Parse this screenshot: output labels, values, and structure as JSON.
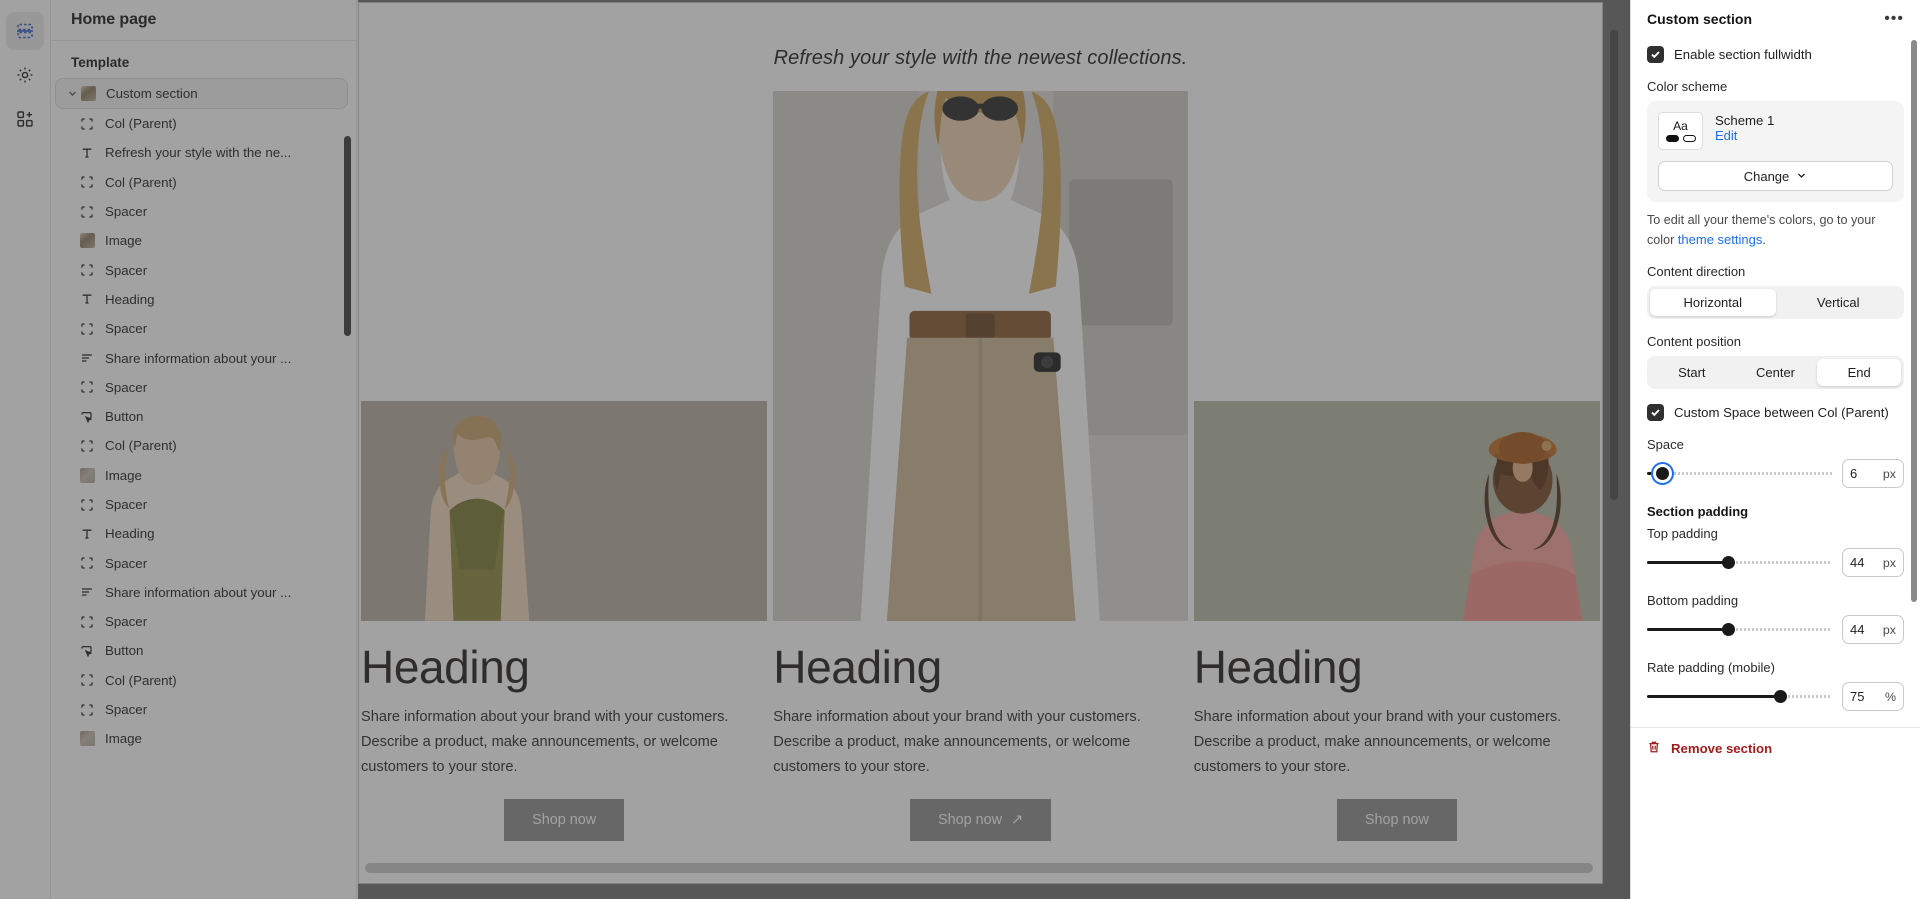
{
  "rail": {
    "items": [
      {
        "name": "sections-icon",
        "label": "Sections",
        "selected": true
      },
      {
        "name": "settings-icon",
        "label": "Theme settings",
        "selected": false
      },
      {
        "name": "app-blocks-icon",
        "label": "App embeds",
        "selected": false
      }
    ]
  },
  "sidebar": {
    "page_title": "Home page",
    "group_label": "Template",
    "section": {
      "label": "Custom section",
      "icon": "image-thumbnail"
    },
    "items": [
      {
        "label": "Col (Parent)",
        "icon": "frame-icon"
      },
      {
        "label": "Refresh your style with the ne...",
        "icon": "text-icon"
      },
      {
        "label": "Col (Parent)",
        "icon": "frame-icon"
      },
      {
        "label": "Spacer",
        "icon": "frame-icon"
      },
      {
        "label": "Image",
        "icon": "image-thumbnail"
      },
      {
        "label": "Spacer",
        "icon": "frame-icon"
      },
      {
        "label": "Heading",
        "icon": "text-icon"
      },
      {
        "label": "Spacer",
        "icon": "frame-icon"
      },
      {
        "label": "Share information about your ...",
        "icon": "paragraph-icon"
      },
      {
        "label": "Spacer",
        "icon": "frame-icon"
      },
      {
        "label": "Button",
        "icon": "button-icon"
      },
      {
        "label": "Col (Parent)",
        "icon": "frame-icon"
      },
      {
        "label": "Image",
        "icon": "image-thumbnail"
      },
      {
        "label": "Spacer",
        "icon": "frame-icon"
      },
      {
        "label": "Heading",
        "icon": "text-icon"
      },
      {
        "label": "Spacer",
        "icon": "frame-icon"
      },
      {
        "label": "Share information about your ...",
        "icon": "paragraph-icon"
      },
      {
        "label": "Spacer",
        "icon": "frame-icon"
      },
      {
        "label": "Button",
        "icon": "button-icon"
      },
      {
        "label": "Col (Parent)",
        "icon": "frame-icon"
      },
      {
        "label": "Spacer",
        "icon": "frame-icon"
      },
      {
        "label": "Image",
        "icon": "image-thumbnail"
      }
    ]
  },
  "canvas": {
    "tagline": "Refresh your style with the newest collections.",
    "columns": [
      {
        "id": "left",
        "heading": "Heading",
        "body": "Share information about your brand with your customers. Describe a product, make announcements, or welcome customers to your store.",
        "button": "Shop now",
        "button_arrow": "",
        "image_bg": "#b6ada0"
      },
      {
        "id": "center",
        "heading": "Heading",
        "body": "Share information about your brand with your customers. Describe a product, make announcements, or welcome customers to your store.",
        "button": "Shop now",
        "button_arrow": "↗",
        "image_bg": "#d9d7d2"
      },
      {
        "id": "right",
        "heading": "Heading",
        "body": "Share information about your brand with your customers. Describe a product, make announcements, or welcome customers to your store.",
        "button": "Shop now",
        "button_arrow": "",
        "image_bg": "#b7bba7"
      }
    ]
  },
  "panel": {
    "title": "Custom section",
    "more_label": "•••",
    "fullwidth": {
      "label": "Enable section fullwidth",
      "checked": true
    },
    "color_scheme": {
      "label": "Color scheme",
      "swatch_text": "Aa",
      "name": "Scheme 1",
      "edit_label": "Edit",
      "change_label": "Change",
      "hint_prefix": "To edit all your theme's colors, go to your color ",
      "hint_link": "theme settings",
      "hint_suffix": "."
    },
    "content_direction": {
      "label": "Content direction",
      "options": [
        "Horizontal",
        "Vertical"
      ],
      "selected": "Horizontal"
    },
    "content_position": {
      "label": "Content position",
      "options": [
        "Start",
        "Center",
        "End"
      ],
      "selected": "End"
    },
    "custom_space": {
      "label": "Custom Space between Col (Parent)",
      "checked": true
    },
    "space": {
      "label": "Space",
      "value": "6",
      "unit": "px",
      "percent": 8,
      "focused": true
    },
    "section_padding_label": "Section padding",
    "top_padding": {
      "label": "Top padding",
      "value": "44",
      "unit": "px",
      "percent": 44
    },
    "bottom_padding": {
      "label": "Bottom padding",
      "value": "44",
      "unit": "px",
      "percent": 44
    },
    "rate_padding": {
      "label": "Rate padding (mobile)",
      "value": "75",
      "unit": "%",
      "percent": 72
    },
    "remove_label": "Remove section"
  }
}
